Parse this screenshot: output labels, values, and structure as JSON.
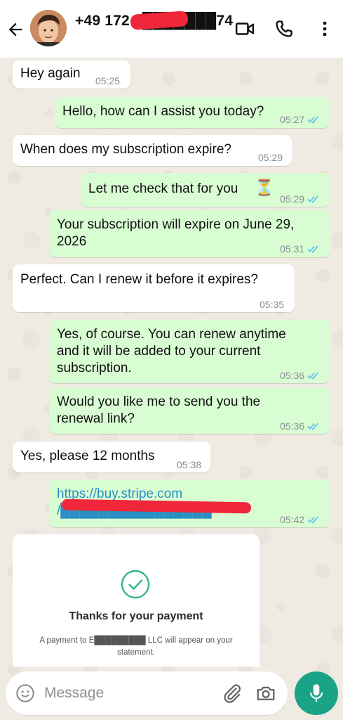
{
  "header": {
    "contact_name": "+49 172 2███████74",
    "icons": [
      "back-arrow-icon",
      "video-call-icon",
      "phone-icon",
      "more-options-icon"
    ]
  },
  "messages": [
    {
      "dir": "in",
      "text": "Hey again",
      "time": "05:25"
    },
    {
      "dir": "out",
      "text": "Hello, how can I assist you today?",
      "time": "05:27",
      "read": true
    },
    {
      "dir": "in",
      "text": "When does my subscription expire?",
      "time": "05:29"
    },
    {
      "dir": "out",
      "text": "Let me check that for you",
      "emoji": "⏳",
      "time": "05:29",
      "read": true
    },
    {
      "dir": "out",
      "text": "Your subscription will expire on June 29,\n2026",
      "time": "05:31",
      "read": true
    },
    {
      "dir": "in",
      "text": "Perfect. Can I renew it before it expires?",
      "time": "05:35"
    },
    {
      "dir": "out",
      "text": "Yes, of course. You can renew anytime\nand it will be added to your current\nsubscription.",
      "time": "05:36",
      "read": true
    },
    {
      "dir": "out",
      "text": "Would you like me to send you the\nrenewal link?",
      "time": "05:36",
      "read": true
    },
    {
      "dir": "in",
      "text": "Yes, please 12 months",
      "time": "05:38"
    },
    {
      "dir": "out",
      "text": "https://buy.stripe.com\n/████████████████",
      "time": "05:42",
      "read": true,
      "is_link": true
    }
  ],
  "payment_card": {
    "title": "Thanks for your payment",
    "subtitle": "A payment to E█████████ LLC will appear on your statement."
  },
  "composer": {
    "placeholder": "Message"
  },
  "colors": {
    "outgoing_bubble": "#d9fdd3",
    "incoming_bubble": "#ffffff",
    "accent": "#1aa386",
    "read_tick": "#53bdeb",
    "redaction": "#f0263a"
  }
}
